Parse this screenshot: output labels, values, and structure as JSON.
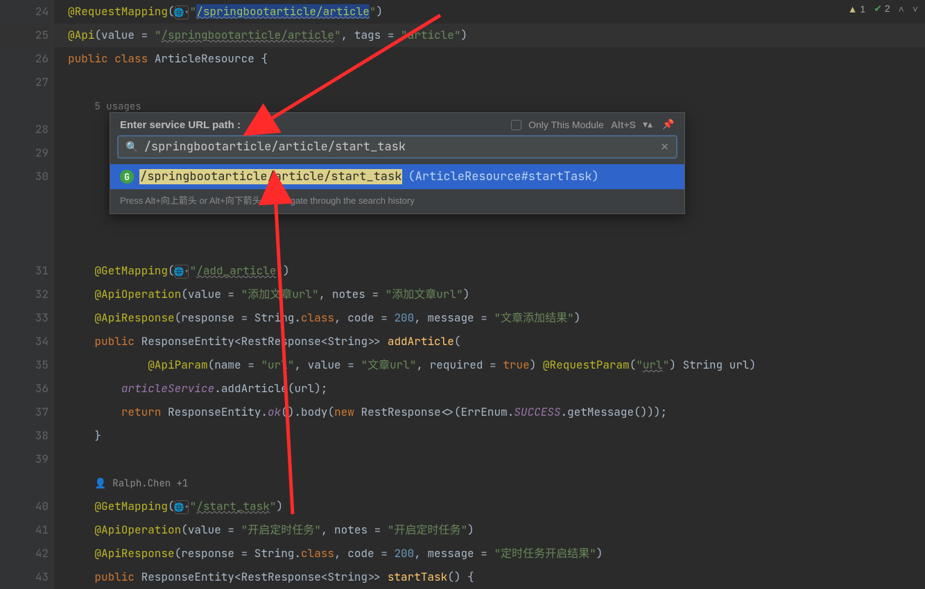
{
  "status": {
    "warnCount": "1",
    "okCount": "2"
  },
  "gutter": [
    "24",
    "25",
    "26",
    "27",
    "",
    "28",
    "29",
    "30",
    "",
    "",
    "",
    "31",
    "32",
    "33",
    "34",
    "35",
    "36",
    "37",
    "38",
    "39",
    "",
    "40",
    "41",
    "42",
    "43"
  ],
  "code": {
    "l24_path": "/springbootarticle/article",
    "l25_val": "/springbootarticle/article",
    "l25_tags": "article",
    "l26_cls": "ArticleResource",
    "usages": "5 usages",
    "l31_path": "/add_article",
    "l32_val": "添加文章url",
    "l32_notes": "添加文章url",
    "l33_code": "200",
    "l33_msg": "文章添加结果",
    "l34_ret": "ResponseEntity",
    "l34_inner": "RestResponse",
    "l34_t": "String",
    "l34_m": "addArticle",
    "l35_name": "url",
    "l35_val": "文章url",
    "l35_param": "url",
    "l36_svc": "articleService",
    "l36_m": "addArticle",
    "l36_arg": "url",
    "l37_ok": "ok",
    "l37_body": "body",
    "l37_cls": "RestResponse",
    "l37_enum": "ErrEnum",
    "l37_succ": "SUCCESS",
    "l37_gm": "getMessage",
    "author": "Ralph.Chen +1",
    "l40_path": "/start_task",
    "l41_val": "开启定时任务",
    "l41_notes": "开启定时任务",
    "l42_code": "200",
    "l42_msg": "定时任务开启结果",
    "l43_m": "startTask"
  },
  "popup": {
    "title": "Enter service URL path :",
    "onlyThis": "Only This Module",
    "shortcut": "Alt+S",
    "searchValue": "/springbootarticle/article/start_task",
    "result_path": "/springbootarticle/article/start_task",
    "result_meta": "(ArticleResource#startTask)",
    "footer": "Press Alt+向上箭头 or Alt+向下箭头 to navigate through the search history"
  }
}
